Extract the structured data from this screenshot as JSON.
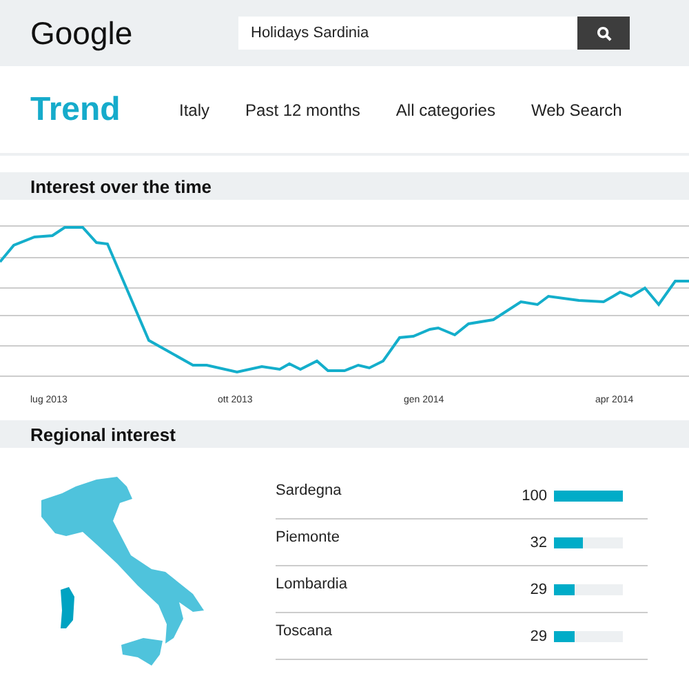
{
  "header": {
    "logo": "Google",
    "search": {
      "value": "Holidays Sardinia"
    }
  },
  "filters": {
    "title": "Trend",
    "items": [
      "Italy",
      "Past 12 months",
      "All categories",
      "Web Search"
    ]
  },
  "interest_over_time": {
    "title": "Interest over the time",
    "x_labels": [
      "lug 2013",
      "ott 2013",
      "gen 2014",
      "apr 2014"
    ]
  },
  "regional_interest": {
    "title": "Regional interest",
    "regions": [
      {
        "name": "Sardegna",
        "value": "100",
        "level": 1
      },
      {
        "name": "Piemonte",
        "value": "32",
        "level": 0.42
      },
      {
        "name": "Lombardia",
        "value": "29",
        "level": 0.3
      },
      {
        "name": "Toscana",
        "value": "29",
        "level": 0.3
      }
    ]
  }
}
